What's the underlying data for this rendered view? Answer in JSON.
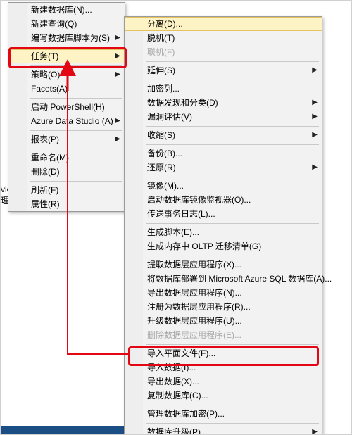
{
  "bg": {
    "line1": "vices 目录",
    "line2": "理"
  },
  "m1": {
    "new_db": "新建数据库(N)...",
    "new_query": "新建查询(Q)",
    "script_db_as": "编写数据库脚本为(S)",
    "tasks": "任务(T)",
    "policies": "策略(O)",
    "facets": "Facets(A)",
    "powershell": "启动 PowerShell(H)",
    "ads": "Azure Data Studio (A)",
    "reports": "报表(P)",
    "rename": "重命名(M)",
    "delete": "删除(D)",
    "refresh": "刷新(F)",
    "properties": "属性(R)"
  },
  "m2": {
    "detach": "分离(D)...",
    "offline": "脱机(T)",
    "online": "联机(F)",
    "stretch": "延伸(S)",
    "encrypt_cols": "加密列...",
    "disc_class": "数据发现和分类(D)",
    "vuln": "漏洞评估(V)",
    "shrink": "收缩(S)",
    "backup": "备份(B)...",
    "restore": "还原(R)",
    "mirror": "镜像(M)...",
    "launch_monitor": "启动数据库镜像监视器(O)...",
    "ship_logs": "传送事务日志(L)...",
    "gen_scripts": "生成脚本(E)...",
    "oltp": "生成内存中 OLTP 迁移清单(G)",
    "extract_dac": "提取数据层应用程序(X)...",
    "deploy_azure": "将数据库部署到 Microsoft Azure SQL 数据库(A)...",
    "export_dac": "导出数据层应用程序(N)...",
    "register_dac": "注册为数据层应用程序(R)...",
    "upgrade_dac": "升级数据层应用程序(U)...",
    "delete_dac": "删除数据层应用程序(E)...",
    "import_flat": "导入平面文件(F)...",
    "import_data": "导入数据(I)...",
    "export_data": "导出数据(X)...",
    "copy_db": "复制数据库(C)...",
    "manage_enc": "管理数据库加密(P)...",
    "upgrade_db": "数据库升级(P)"
  },
  "arrow": "▶"
}
